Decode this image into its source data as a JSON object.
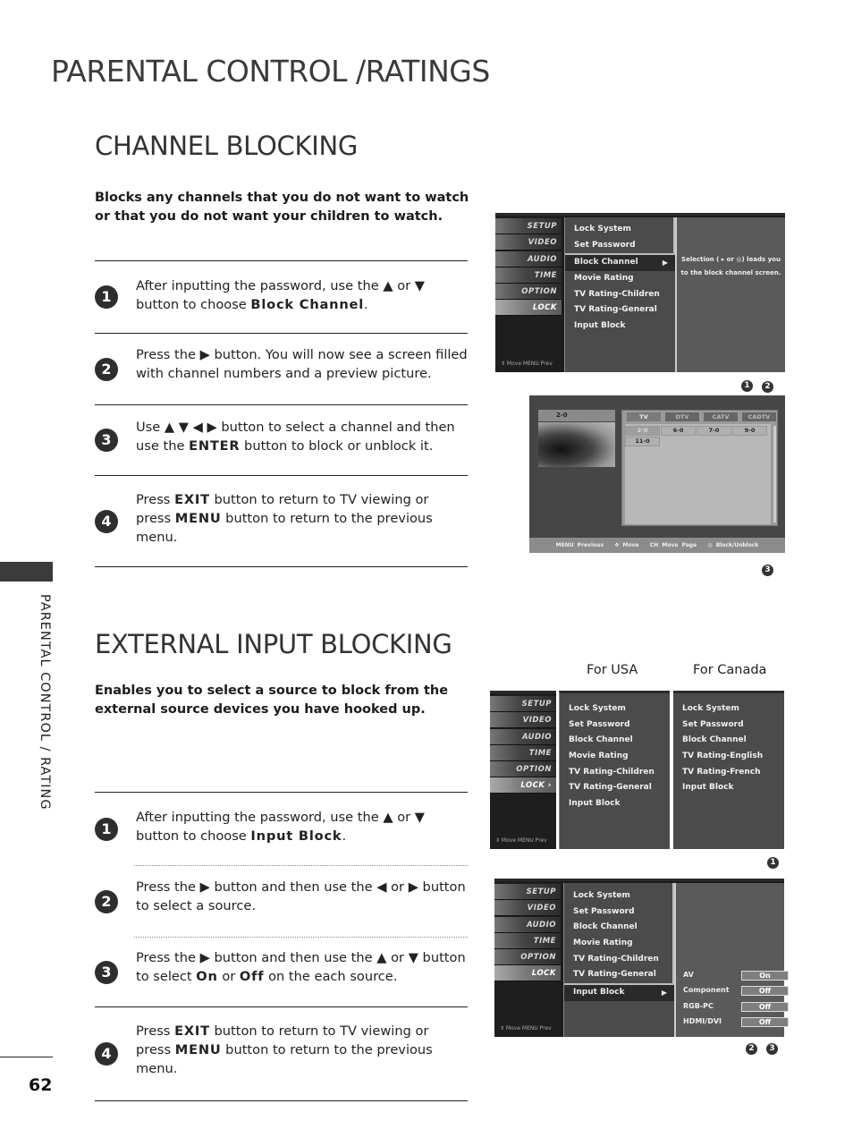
{
  "page_title": "PARENTAL CONTROL /RATINGS",
  "side_label": "PARENTAL CONTROL / RATING",
  "page_number": "62",
  "channel_blocking": {
    "title": "CHANNEL BLOCKING",
    "intro": "Blocks any channels that you do not want to watch or that you do not want your children to watch.",
    "steps": [
      {
        "num": "1",
        "pre": "After inputting the password, use the  ▲ or ▼ button to choose ",
        "kw": "Block Channel",
        "post": "."
      },
      {
        "num": "2",
        "pre": "Press the ▶ button. You will now see a screen filled with channel numbers and a preview picture.",
        "kw": "",
        "post": ""
      },
      {
        "num": "3",
        "pre": "Use ▲ ▼ ◀ ▶ button to select a channel and then use the ",
        "kw": "ENTER",
        "post": " button to block or unblock it."
      },
      {
        "num": "4",
        "pre": "Press ",
        "kw": "EXIT",
        "mid": " button to return to TV viewing or press ",
        "kw2": "MENU",
        "post": " button to return to the previous menu."
      }
    ],
    "menu": {
      "categories": [
        "SETUP",
        "VIDEO",
        "AUDIO",
        "TIME",
        "OPTION",
        "LOCK"
      ],
      "items": [
        "Lock System",
        "Set Password",
        "Block Channel",
        "Movie Rating",
        "TV Rating-Children",
        "TV Rating-General",
        "Input Block"
      ],
      "selected": "Block Channel",
      "arrow": "▶",
      "help_line1": "Selection ( ▸ or  ◎) leads you",
      "help_line2": "to the block channel screen.",
      "footer": "⇕ Move   MENU Prev",
      "callouts": [
        "1",
        "2"
      ]
    },
    "channel_screen": {
      "preview_channel": "2-0",
      "tabs": [
        "TV",
        "DTV",
        "CATV",
        "CADTV"
      ],
      "active_tab": "TV",
      "channels": [
        "2-0",
        "6-0",
        "7-0",
        "9-0",
        "11-0"
      ],
      "selected_channel": "2-0",
      "footer": {
        "previous": "MENU Previous",
        "move": "✥ Move",
        "move_page": "CH Move Page",
        "block": "◎ Block/Unblock"
      },
      "callout": "3"
    }
  },
  "external_input_blocking": {
    "title": "EXTERNAL INPUT BLOCKING",
    "intro": "Enables you to select a source to block from the external source devices you have hooked up.",
    "label_usa": "For USA",
    "label_canada": "For Canada",
    "steps": [
      {
        "num": "1",
        "pre": "After inputting the password, use the ▲ or ▼ button to choose ",
        "kw": "Input Block",
        "post": "."
      },
      {
        "num": "2",
        "pre": "Press the ▶ button and then use the ◀ or ▶ button to select a source.",
        "kw": "",
        "post": ""
      },
      {
        "num": "3",
        "pre": "Press the ▶ button and then use the ▲ or ▼ button to select ",
        "kw": "On",
        "mid": " or ",
        "kw2": "Off",
        "post": " on the each source."
      },
      {
        "num": "4",
        "pre": "Press ",
        "kw": "EXIT",
        "mid": " button to return to TV viewing or press ",
        "kw2": "MENU",
        "post": " button to return to the previous menu."
      }
    ],
    "menu_usa": {
      "categories": [
        "SETUP",
        "VIDEO",
        "AUDIO",
        "TIME",
        "OPTION",
        "LOCK ›"
      ],
      "items": [
        "Lock System",
        "Set Password",
        "Block Channel",
        "Movie Rating",
        "TV Rating-Children",
        "TV Rating-General",
        "Input Block"
      ]
    },
    "menu_canada": {
      "items": [
        "Lock System",
        "Set Password",
        "Block Channel",
        "TV Rating-English",
        "TV Rating-French",
        "Input Block"
      ]
    },
    "menu_input": {
      "categories": [
        "SETUP",
        "VIDEO",
        "AUDIO",
        "TIME",
        "OPTION",
        "LOCK"
      ],
      "items": [
        "Lock System",
        "Set Password",
        "Block Channel",
        "Movie Rating",
        "TV Rating-Children",
        "TV Rating-General",
        "Input Block"
      ],
      "selected": "Input Block",
      "sources": [
        {
          "name": "AV",
          "value": "On"
        },
        {
          "name": "Component",
          "value": "Off"
        },
        {
          "name": "RGB-PC",
          "value": "Off"
        },
        {
          "name": "HDMI/DVI",
          "value": "Off"
        }
      ],
      "callouts_top": [
        "1"
      ],
      "callouts_bottom": [
        "2",
        "3"
      ]
    },
    "footer": "⇕ Move   MENU Prev"
  }
}
